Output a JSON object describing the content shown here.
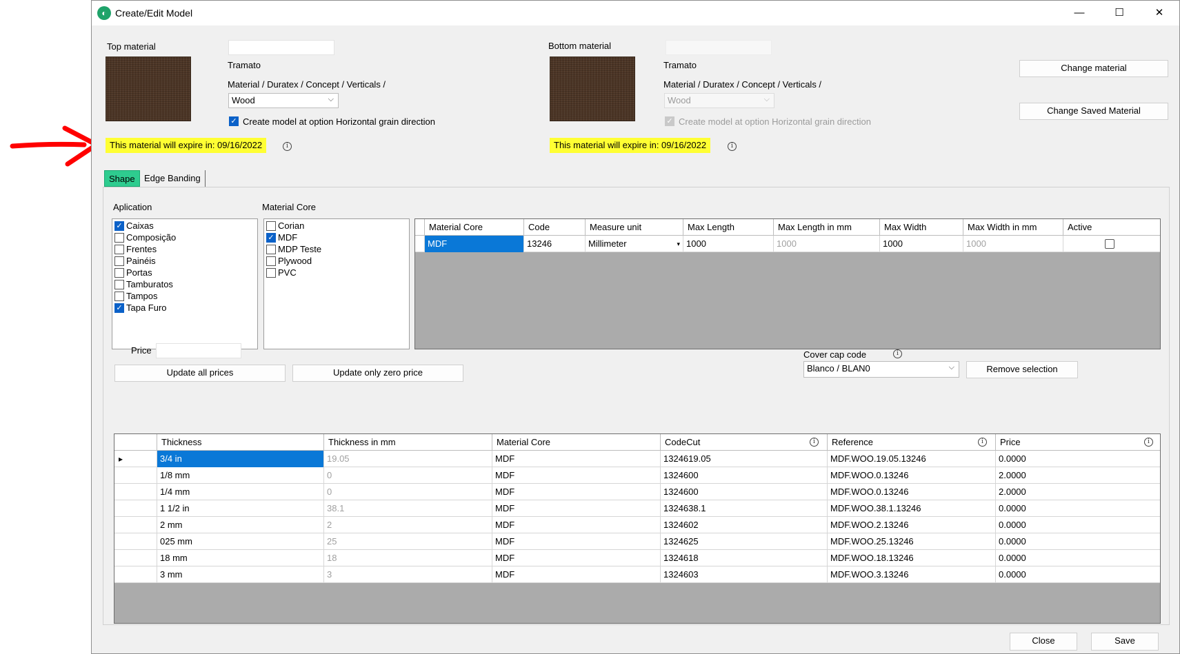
{
  "window": {
    "title": "Create/Edit Model",
    "controls": {
      "minimize": "—",
      "maximize": "☐",
      "close": "✕"
    }
  },
  "top_material": {
    "label": "Top material",
    "name_value": "",
    "texture_name": "Tramato",
    "path": "Material / Duratex / Concept / Verticals /",
    "type_value": "Wood",
    "grain_checked": true,
    "grain_label": "Create model at option Horizontal grain direction",
    "expire_text": "This material will expire in:  09/16/2022"
  },
  "bottom_material": {
    "label": "Bottom material",
    "name_value": "",
    "texture_name": "Tramato",
    "path": "Material / Duratex / Concept / Verticals /",
    "type_value": "Wood",
    "grain_checked": true,
    "grain_label": "Create model at option Horizontal grain direction",
    "expire_text": "This material will expire in:  09/16/2022"
  },
  "buttons": {
    "change_material": "Change material",
    "change_saved_material": "Change Saved Material",
    "update_all_prices": "Update all prices",
    "update_zero_price": "Update only zero price",
    "remove_selection": "Remove selection",
    "close": "Close",
    "save": "Save"
  },
  "tabs": [
    {
      "label": "Shape",
      "active": true
    },
    {
      "label": "Edge Banding",
      "active": false
    }
  ],
  "application": {
    "label": "Aplication",
    "items": [
      {
        "label": "Caixas",
        "checked": true
      },
      {
        "label": "Composição",
        "checked": false
      },
      {
        "label": "Frentes",
        "checked": false
      },
      {
        "label": "Painéis",
        "checked": false
      },
      {
        "label": "Portas",
        "checked": false
      },
      {
        "label": "Tamburatos",
        "checked": false
      },
      {
        "label": "Tampos",
        "checked": false
      },
      {
        "label": "Tapa Furo",
        "checked": true
      }
    ]
  },
  "material_core": {
    "label": "Material Core",
    "items": [
      {
        "label": "Corian",
        "checked": false
      },
      {
        "label": "MDF",
        "checked": true
      },
      {
        "label": "MDP Teste",
        "checked": false
      },
      {
        "label": "Plywood",
        "checked": false
      },
      {
        "label": "PVC",
        "checked": false
      }
    ]
  },
  "core_grid": {
    "columns": [
      "Material Core",
      "Code",
      "Measure unit",
      "Max Length",
      "Max Length in mm",
      "Max Width",
      "Max Width in mm",
      "Active"
    ],
    "rows": [
      {
        "core": "MDF",
        "code": "13246",
        "unit": "Millimeter",
        "max_length": "1000",
        "max_length_mm": "1000",
        "max_width": "1000",
        "max_width_mm": "1000",
        "active": false
      }
    ]
  },
  "price": {
    "label": "Price",
    "value": ""
  },
  "cover_cap": {
    "label": "Cover cap code",
    "value": "Blanco / BLAN0"
  },
  "thickness_grid": {
    "columns": [
      "Thickness",
      "Thickness in mm",
      "Material Core",
      "CodeCut",
      "Reference",
      "Price"
    ],
    "rows": [
      {
        "thickness": "3/4 in",
        "mm": "19.05",
        "core": "MDF",
        "codecut": "1324619.05",
        "reference": "MDF.WOO.19.05.13246",
        "price": "0.0000"
      },
      {
        "thickness": "1/8 mm",
        "mm": "0",
        "core": "MDF",
        "codecut": "1324600",
        "reference": "MDF.WOO.0.13246",
        "price": "2.0000"
      },
      {
        "thickness": "1/4 mm",
        "mm": "0",
        "core": "MDF",
        "codecut": "1324600",
        "reference": "MDF.WOO.0.13246",
        "price": "2.0000"
      },
      {
        "thickness": "1 1/2 in",
        "mm": "38.1",
        "core": "MDF",
        "codecut": "1324638.1",
        "reference": "MDF.WOO.38.1.13246",
        "price": "0.0000"
      },
      {
        "thickness": "2 mm",
        "mm": "2",
        "core": "MDF",
        "codecut": "1324602",
        "reference": "MDF.WOO.2.13246",
        "price": "0.0000"
      },
      {
        "thickness": "025 mm",
        "mm": "25",
        "core": "MDF",
        "codecut": "1324625",
        "reference": "MDF.WOO.25.13246",
        "price": "0.0000"
      },
      {
        "thickness": "18 mm",
        "mm": "18",
        "core": "MDF",
        "codecut": "1324618",
        "reference": "MDF.WOO.18.13246",
        "price": "0.0000"
      },
      {
        "thickness": "3 mm",
        "mm": "3",
        "core": "MDF",
        "codecut": "1324603",
        "reference": "MDF.WOO.3.13246",
        "price": "0.0000"
      }
    ]
  },
  "colors": {
    "highlight": "#ffff33",
    "annotation_arrow": "#ff0000",
    "tab_active": "#2ecc8f",
    "selection": "#0a78d7",
    "swatch": "#4d3626"
  }
}
